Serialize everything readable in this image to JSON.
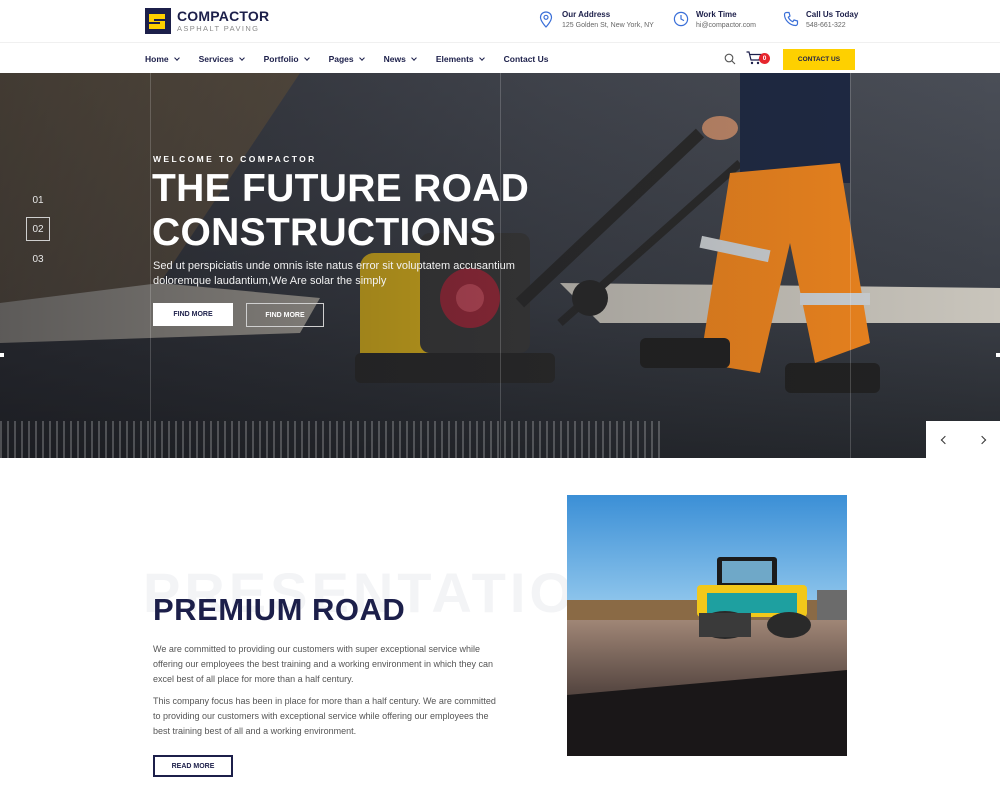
{
  "brand": {
    "name": "COMPACTOR",
    "tagline": "ASPHALT PAVING",
    "colors": {
      "navy": "#1c1f4a",
      "yellow": "#fed000",
      "badge": "#e6252d"
    }
  },
  "contact_info": [
    {
      "icon": "map-pin-icon",
      "title": "Our Address",
      "value": "125 Golden St, New York, NY"
    },
    {
      "icon": "clock-icon",
      "title": "Work Time",
      "value": "hi@compactor.com"
    },
    {
      "icon": "phone-icon",
      "title": "Call Us Today",
      "value": "548-661-322"
    }
  ],
  "nav": {
    "items": [
      {
        "label": "Home",
        "dropdown": true
      },
      {
        "label": "Services",
        "dropdown": true
      },
      {
        "label": "Portfolio",
        "dropdown": true
      },
      {
        "label": "Pages",
        "dropdown": true
      },
      {
        "label": "News",
        "dropdown": true
      },
      {
        "label": "Elements",
        "dropdown": true
      },
      {
        "label": "Contact Us",
        "dropdown": false
      }
    ],
    "cart_count": "0",
    "cta_label": "CONTACT US"
  },
  "hero": {
    "kicker": "WELCOME TO COMPACTOR",
    "title_line1": "THE FUTURE ROAD",
    "title_line2": "CONSTRUCTIONS",
    "description": "Sed ut perspiciatis unde omnis iste natus error sit voluptatem accusantium doloremque laudantium,We Are solar the simply",
    "button_primary": "FIND MORE",
    "button_secondary": "FIND MORE",
    "slides": [
      "01",
      "02",
      "03"
    ],
    "active_slide": "02"
  },
  "about": {
    "watermark": "PRESENTATION",
    "title_part1": "PREMIUM",
    "title_part2": "ROAD",
    "paragraph1": "We are committed to providing our customers with super exceptional service while offering our employees the best training and a working environment in which they can excel best of all place for more than a half century.",
    "paragraph2": "This company focus has been in place for more than a half century. We are committed to providing our customers with exceptional service while offering our employees the best training best of all and a working environment.",
    "button_label": "READ MORE"
  }
}
